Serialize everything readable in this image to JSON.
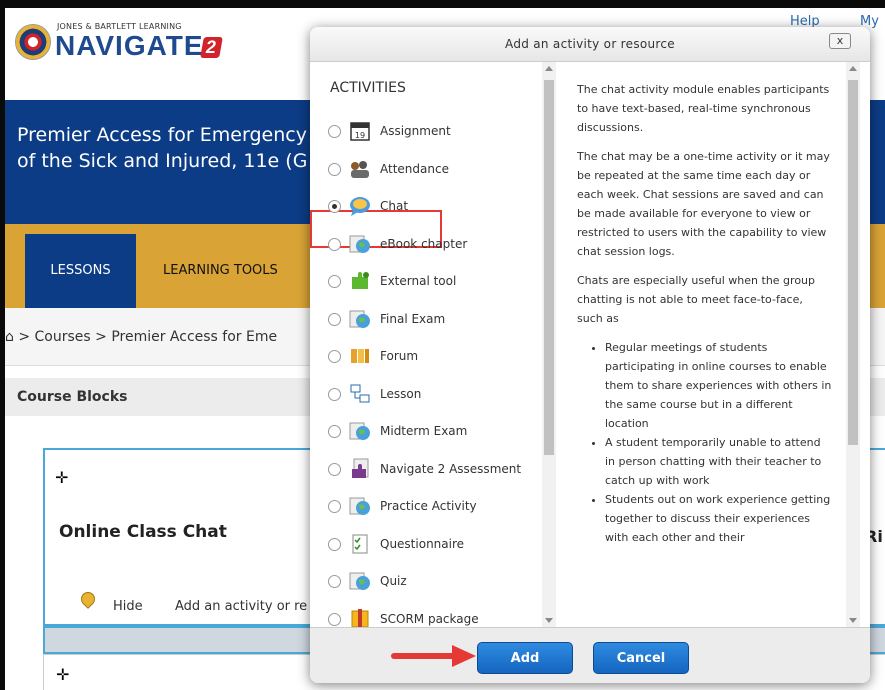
{
  "header": {
    "brand_small": "JONES & BARTLETT LEARNING",
    "brand_name": "NAVIGATE",
    "brand_number": "2",
    "help_link": "Help",
    "my_link": "My"
  },
  "banner": {
    "line1": "Premier Access for Emergency",
    "line2": "of the Sick and Injured, 11e (G"
  },
  "nav": {
    "lessons": "LESSONS",
    "learning_tools": "LEARNING TOOLS"
  },
  "breadcrumb": "⌂  >  Courses  >  Premier Access for Eme",
  "course_blocks": "Course Blocks",
  "block1": {
    "move": "✛",
    "title": "Online Class Chat",
    "hide": "Hide",
    "add": "Add an activity or re",
    "right_title": "Ri"
  },
  "block2": {
    "move": "✛"
  },
  "modal": {
    "title": "Add an activity or resource",
    "close": "x",
    "activities_heading": "ACTIVITIES",
    "activities": [
      {
        "label": "Assignment",
        "icon": "assignment-icon",
        "checked": false
      },
      {
        "label": "Attendance",
        "icon": "attendance-icon",
        "checked": false
      },
      {
        "label": "Chat",
        "icon": "chat-icon",
        "checked": true
      },
      {
        "label": "eBook chapter",
        "icon": "ebook-icon",
        "checked": false
      },
      {
        "label": "External tool",
        "icon": "external-tool-icon",
        "checked": false
      },
      {
        "label": "Final Exam",
        "icon": "final-exam-icon",
        "checked": false
      },
      {
        "label": "Forum",
        "icon": "forum-icon",
        "checked": false
      },
      {
        "label": "Lesson",
        "icon": "lesson-icon",
        "checked": false
      },
      {
        "label": "Midterm Exam",
        "icon": "midterm-exam-icon",
        "checked": false
      },
      {
        "label": "Navigate 2 Assessment",
        "icon": "assessment-icon",
        "checked": false
      },
      {
        "label": "Practice Activity",
        "icon": "practice-activity-icon",
        "checked": false
      },
      {
        "label": "Questionnaire",
        "icon": "questionnaire-icon",
        "checked": false
      },
      {
        "label": "Quiz",
        "icon": "quiz-icon",
        "checked": false
      },
      {
        "label": "SCORM package",
        "icon": "scorm-icon",
        "checked": false
      }
    ],
    "description": {
      "p1": "The chat activity module enables participants to have text-based, real-time synchronous discussions.",
      "p2": "The chat may be a one-time activity or it may be repeated at the same time each day or each week. Chat sessions are saved and can be made available for everyone to view or restricted to users with the capability to view chat session logs.",
      "p3": "Chats are especially useful when the group chatting is not able to meet face-to-face, such as",
      "bullets": [
        "Regular meetings of students participating in online courses to enable them to share experiences with others in the same course but in a different location",
        "A student temporarily unable to attend in person chatting with their teacher to catch up with work",
        "Students out on work experience getting together to discuss their experiences with each other and their"
      ]
    },
    "add_button": "Add",
    "cancel_button": "Cancel"
  },
  "colors": {
    "banner": "#0c3c86",
    "nav": "#d9a336",
    "button": "#1e7ad6",
    "highlight": "#e53935"
  }
}
